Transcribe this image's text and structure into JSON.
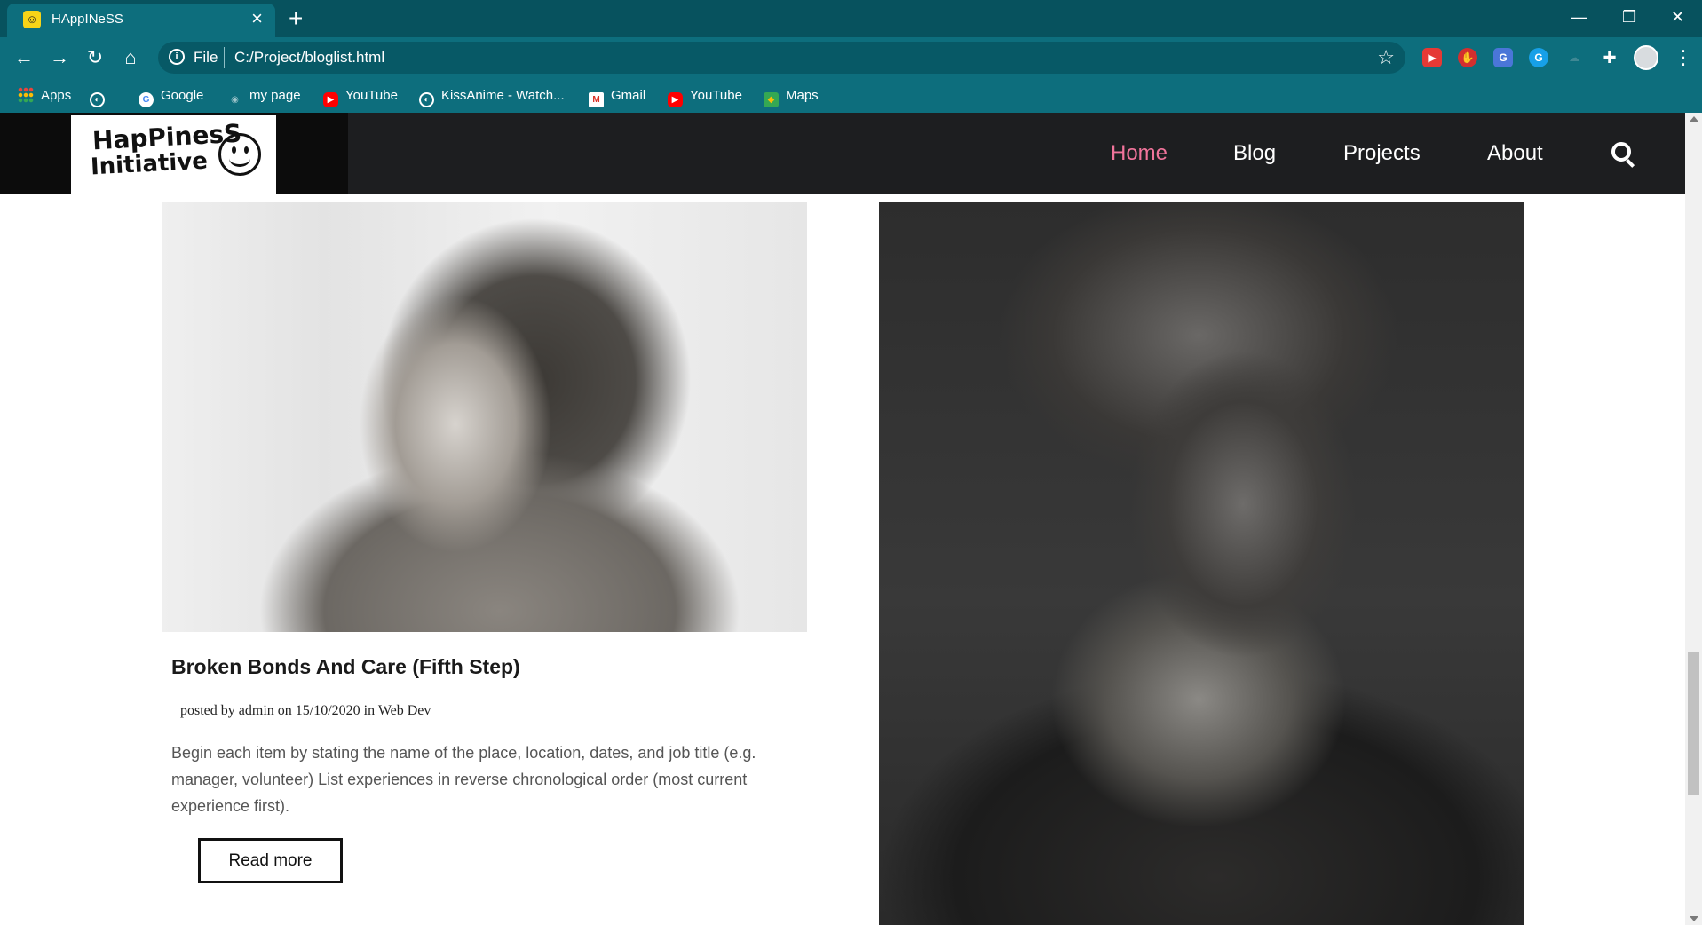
{
  "browser": {
    "tab_title": "HAppINeSS",
    "tab_favicon": "smiley-face-icon",
    "url_scheme": "File",
    "url": "C:/Project/bloglist.html",
    "bookmarks": [
      {
        "label": "Apps",
        "icon": "apps-grid-icon"
      },
      {
        "label": "",
        "icon": "globe-icon"
      },
      {
        "label": "Google",
        "icon": "google-icon"
      },
      {
        "label": "my page",
        "icon": "page-icon"
      },
      {
        "label": "YouTube",
        "icon": "youtube-icon"
      },
      {
        "label": "KissAnime - Watch...",
        "icon": "globe-icon"
      },
      {
        "label": "Gmail",
        "icon": "gmail-icon"
      },
      {
        "label": "YouTube",
        "icon": "youtube-icon"
      },
      {
        "label": "Maps",
        "icon": "maps-icon"
      }
    ]
  },
  "site": {
    "logo": {
      "line1": "HapPinesS",
      "line2": "Initiative"
    },
    "nav": [
      {
        "label": "Home",
        "active": true
      },
      {
        "label": "Blog",
        "active": false
      },
      {
        "label": "Projects",
        "active": false
      },
      {
        "label": "About",
        "active": false
      }
    ],
    "accent_color": "#f1749b",
    "header_color": "#1d1e20"
  },
  "posts": [
    {
      "title": "Broken Bonds And Care (Fifth Step)",
      "meta": "posted by admin on 15/10/2020 in Web Dev",
      "excerpt": "Begin each item by stating the name of the place, location, dates, and job title (e.g. manager, volunteer) List experiences in reverse chronological order (most current experience first).",
      "read_more": "Read more"
    }
  ]
}
